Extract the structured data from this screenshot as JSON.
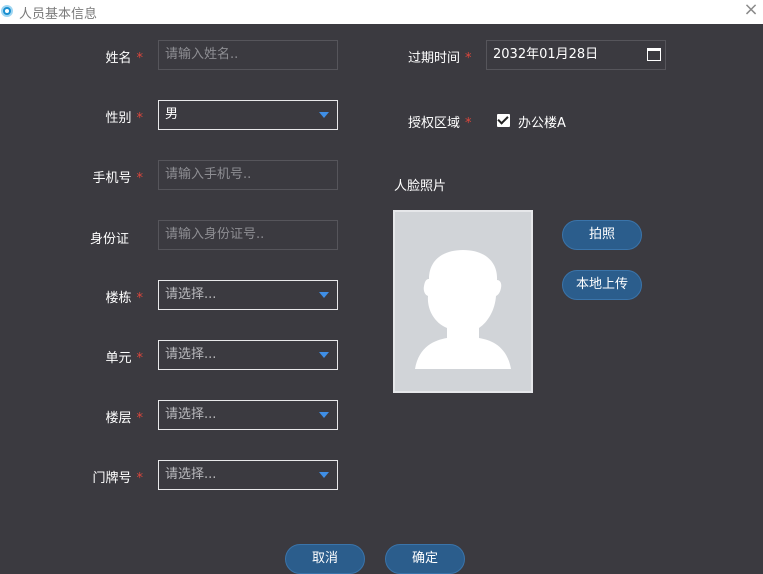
{
  "window": {
    "title": "人员基本信息",
    "close_glyph": "×"
  },
  "form": {
    "name": {
      "label": "姓名",
      "placeholder": "请输入姓名.."
    },
    "gender": {
      "label": "性别",
      "value": "男"
    },
    "phone": {
      "label": "手机号",
      "placeholder": "请输入手机号.."
    },
    "id_card": {
      "label": "身份证",
      "placeholder": "请输入身份证号.."
    },
    "building": {
      "label": "楼栋",
      "placeholder": "请选择..."
    },
    "unit": {
      "label": "单元",
      "placeholder": "请选择..."
    },
    "floor": {
      "label": "楼层",
      "placeholder": "请选择..."
    },
    "door": {
      "label": "门牌号",
      "placeholder": "请选择..."
    },
    "expiry": {
      "label": "过期时间",
      "value": "2032年01月28日"
    },
    "auth_area": {
      "label": "授权区域",
      "option": "办公楼A",
      "checked": true
    },
    "required_mark": "*"
  },
  "photo": {
    "label": "人脸照片",
    "capture_button": "拍照",
    "upload_button": "本地上传"
  },
  "footer": {
    "cancel_button": "取消",
    "confirm_button": "确定"
  },
  "colors": {
    "background": "#3b3a40",
    "accent": "#3f8fe6",
    "button": "#2b5d8c",
    "required": "#e0473c"
  }
}
